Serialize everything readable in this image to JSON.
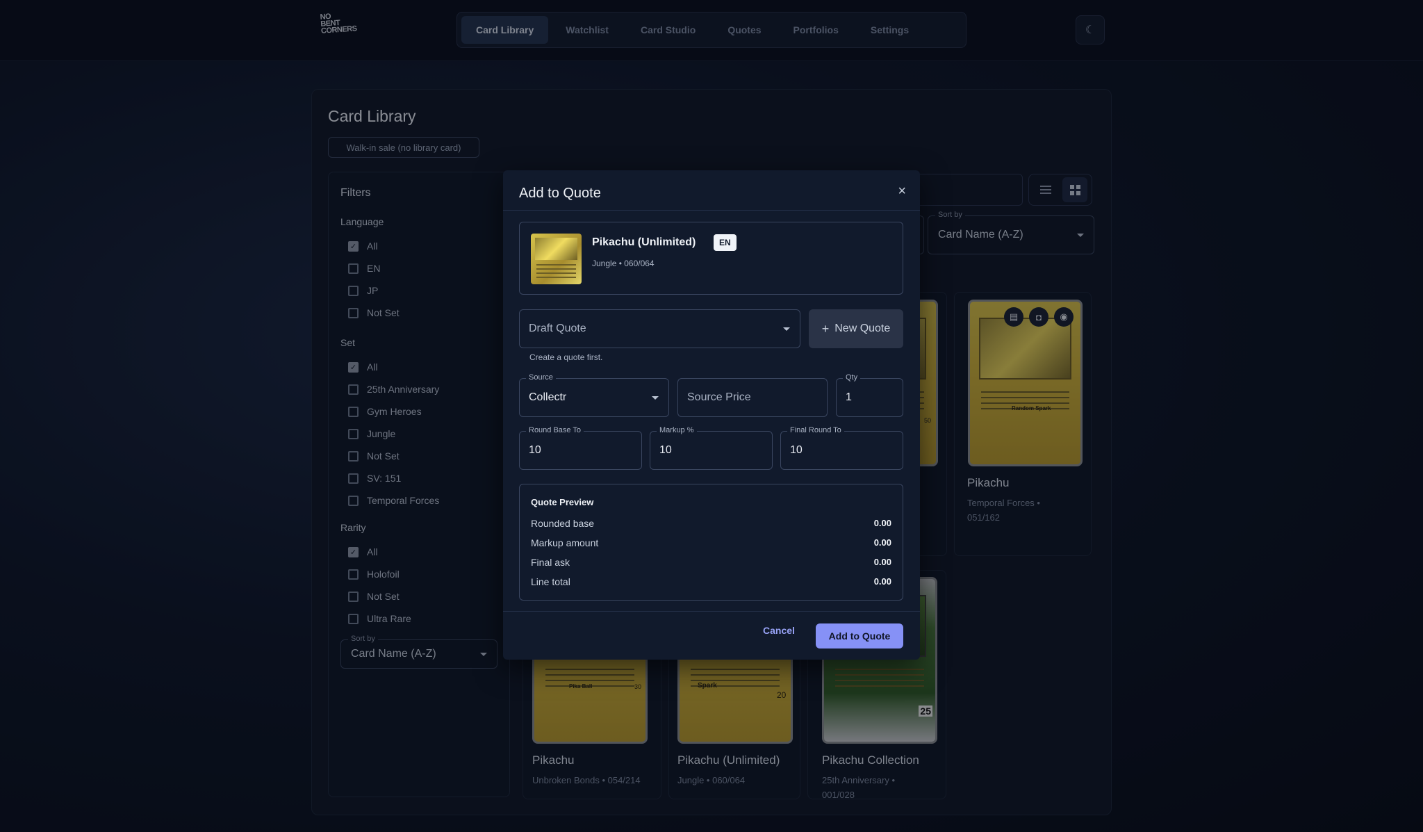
{
  "nav": {
    "items": [
      "Card Library",
      "Watchlist",
      "Card Studio",
      "Quotes",
      "Portfolios",
      "Settings"
    ],
    "active": "Card Library",
    "logo_lines": [
      "NO",
      "BENT",
      "CORNERS"
    ]
  },
  "page": {
    "title": "Card Library",
    "walkin_label": "Walk-in sale (no library card)"
  },
  "filters": {
    "title": "Filters",
    "language": {
      "title": "Language",
      "options": [
        {
          "label": "All",
          "checked": true
        },
        {
          "label": "EN",
          "checked": false
        },
        {
          "label": "JP",
          "checked": false
        },
        {
          "label": "Not Set",
          "checked": false
        }
      ]
    },
    "set": {
      "title": "Set",
      "options": [
        {
          "label": "All",
          "checked": true
        },
        {
          "label": "25th Anniversary",
          "checked": false
        },
        {
          "label": "Gym Heroes",
          "checked": false
        },
        {
          "label": "Jungle",
          "checked": false
        },
        {
          "label": "Not Set",
          "checked": false
        },
        {
          "label": "SV: 151",
          "checked": false
        },
        {
          "label": "Temporal Forces",
          "checked": false
        }
      ]
    },
    "rarity": {
      "title": "Rarity",
      "options": [
        {
          "label": "All",
          "checked": true
        },
        {
          "label": "Holofoil",
          "checked": false
        },
        {
          "label": "Not Set",
          "checked": false
        },
        {
          "label": "Ultra Rare",
          "checked": false
        }
      ]
    },
    "sort_label": "Sort by",
    "sort_value": "Card Name (A-Z)"
  },
  "toolbar": {
    "sort_label": "Sort by",
    "sort_value": "Card Name (A-Z)"
  },
  "cards": [
    {
      "name": "Pikachu",
      "sub1": "Temporal Forces •",
      "sub2": "051/162"
    },
    {
      "name": "Pikachu",
      "sub1": "Unbroken Bonds • 054/214",
      "sub2": ""
    },
    {
      "name": "Pikachu (Unlimited)",
      "sub1": "Jungle • 060/064",
      "sub2": ""
    },
    {
      "name": "Pikachu Collection",
      "sub1": "25th Anniversary •",
      "sub2": "001/028"
    }
  ],
  "card_art_text": {
    "random_spark": "Random Spark",
    "pika_ball": "Pika Ball",
    "pika_ball_dmg": "30",
    "spark": "Spark",
    "spark_dmg": "20",
    "mid_dmg": "50",
    "set_25": "25"
  },
  "modal": {
    "title": "Add to Quote",
    "close": "×",
    "card": {
      "name": "Pikachu (Unlimited)",
      "badge": "EN",
      "meta": "Jungle • 060/064"
    },
    "quote_select": "Draft Quote",
    "new_quote": "New Quote",
    "helper": "Create a quote first.",
    "source": {
      "label": "Source",
      "value": "Collectr"
    },
    "source_price": {
      "placeholder": "Source Price"
    },
    "qty": {
      "label": "Qty",
      "value": "1"
    },
    "round_base": {
      "label": "Round Base To",
      "value": "10"
    },
    "markup": {
      "label": "Markup %",
      "value": "10"
    },
    "final_round": {
      "label": "Final Round To",
      "value": "10"
    },
    "preview": {
      "title": "Quote Preview",
      "rows": [
        {
          "label": "Rounded base",
          "value": "0.00"
        },
        {
          "label": "Markup amount",
          "value": "0.00"
        },
        {
          "label": "Final ask",
          "value": "0.00"
        },
        {
          "label": "Line total",
          "value": "0.00"
        }
      ]
    },
    "cancel": "Cancel",
    "submit": "Add to Quote"
  }
}
